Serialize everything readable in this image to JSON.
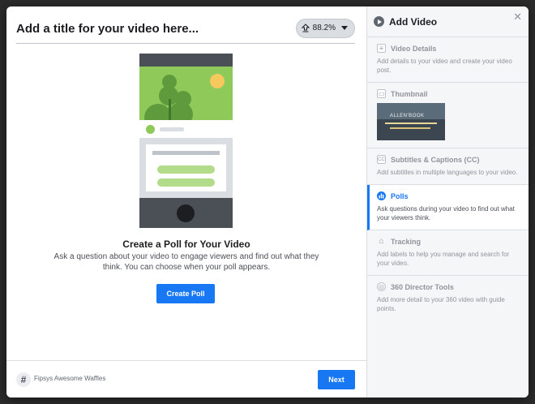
{
  "editor": {
    "title_placeholder": "Add a title for your video here...",
    "upload_progress": "88.2%",
    "upload_progress_fraction": 0.882
  },
  "poll": {
    "heading": "Create a Poll for Your Video",
    "description": "Ask a question about your video to engage viewers and find out what they think. You can choose when your poll appears.",
    "create_button": "Create Poll"
  },
  "footer": {
    "page_name": "Fipsys Awesome Waffles",
    "next_button": "Next"
  },
  "sidebar": {
    "title": "Add Video",
    "steps": [
      {
        "label": "Video Details",
        "description": "Add details to your video and create your video post.",
        "icon": "document-icon",
        "active": false
      },
      {
        "label": "Thumbnail",
        "thumbnail_caption": "ALLEN'BOOK",
        "icon": "image-icon",
        "active": false
      },
      {
        "label": "Subtitles & Captions (CC)",
        "description": "Add subtitles in multiple languages to your video.",
        "icon": "cc-icon",
        "active": false
      },
      {
        "label": "Polls",
        "description": "Ask questions during your video to find out what your viewers think.",
        "icon": "poll-icon",
        "active": true
      },
      {
        "label": "Tracking",
        "description": "Add labels to help you manage and search for your video.",
        "icon": "tag-icon",
        "active": false
      },
      {
        "label": "360 Director Tools",
        "description": "Add more detail to your 360 video with guide points.",
        "icon": "360-icon",
        "active": false
      }
    ]
  },
  "colors": {
    "accent": "#1877f2",
    "illustration_green": "#8ec95a",
    "illustration_dark": "#4b4f56"
  }
}
